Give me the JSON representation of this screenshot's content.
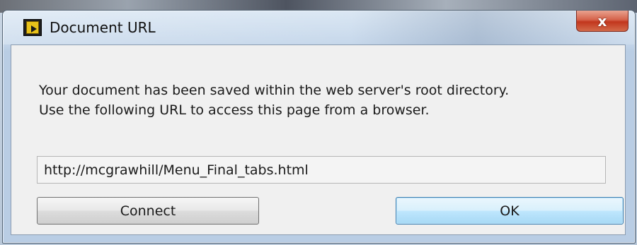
{
  "window": {
    "title": "Document URL",
    "app_icon": "labview-vi-icon",
    "close_symbol": "x",
    "close_icon": "close-icon"
  },
  "message": {
    "line1": "Your document has been saved within the web server's root directory.",
    "line2": "Use the following URL to access this page from a browser."
  },
  "url_field": {
    "value": "http://mcgrawhill/Menu_Final_tabs.html"
  },
  "buttons": {
    "connect_label": "Connect",
    "ok_label": "OK"
  },
  "colors": {
    "close_button": "#c2361d",
    "default_button_border": "#3c7fb1",
    "client_background": "#f0f0f0"
  }
}
